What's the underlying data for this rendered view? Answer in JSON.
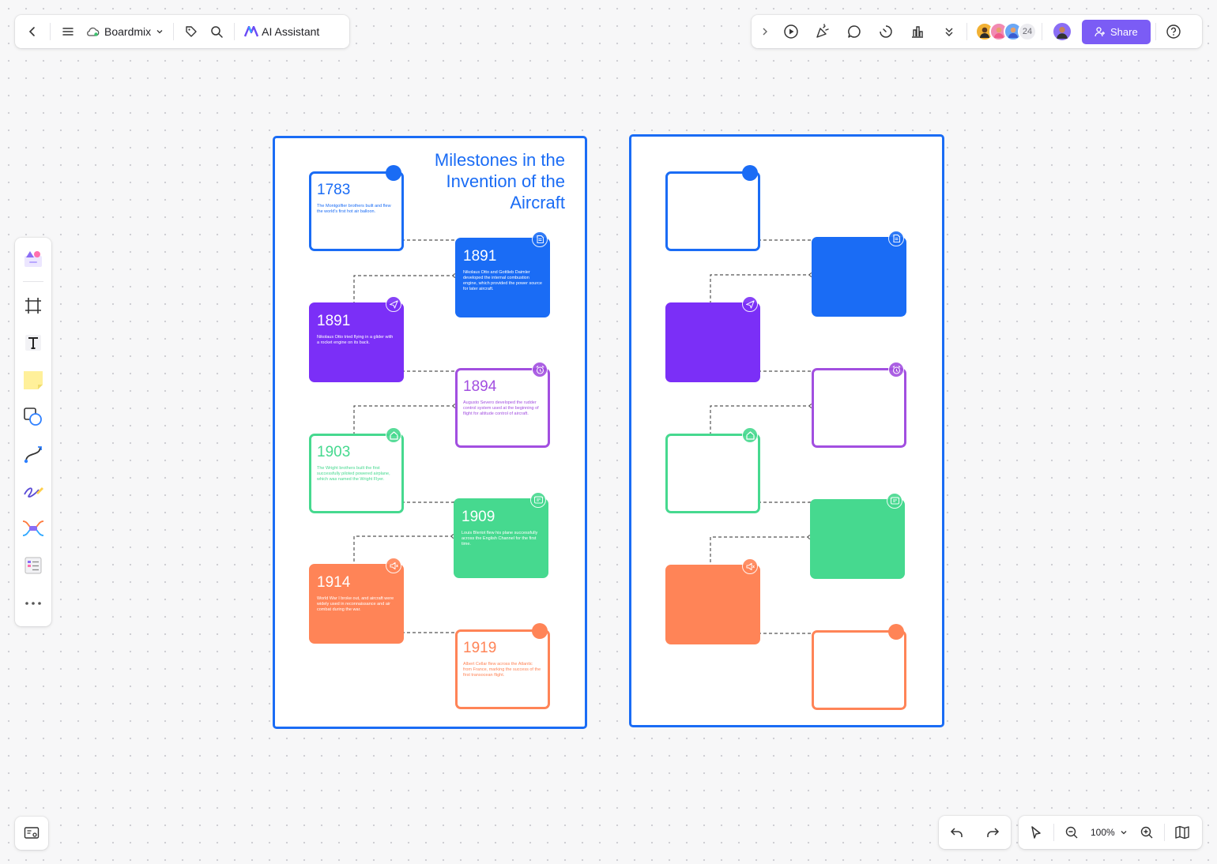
{
  "toolbar": {
    "app_name": "Boardmix",
    "ai_label": "AI Assistant",
    "collaborator_count": "24",
    "share_label": "Share",
    "zoom": "100%"
  },
  "board": {
    "title": "Milestones in the Invention of the Aircraft",
    "milestones": [
      {
        "year": "1783",
        "desc": "The Montgolfier brothers built and flew the world's first hot air balloon.",
        "color": "#1a6cf5",
        "style": "outline",
        "marker": "dot"
      },
      {
        "year": "1891",
        "desc": "Nikolaus Otto and Gottlieb Daimler developed the internal combustion engine, which provided the power source for later aircraft.",
        "color": "#1a6cf5",
        "style": "filled",
        "marker": "doc-icon"
      },
      {
        "year": "1891",
        "desc": "Nikolaus Otto tried flying in a glider with a rocket engine on its back.",
        "color": "#7b2ff7",
        "style": "filled",
        "marker": "send-icon"
      },
      {
        "year": "1894",
        "desc": "Augusto Severo developed the rudder control system used at the beginning of flight for altitude control of aircraft.",
        "color": "#a24fe0",
        "style": "outline",
        "marker": "alarm-icon"
      },
      {
        "year": "1903",
        "desc": "The Wright brothers built the first successfully piloted powered airplane, which was named the Wright Flyer.",
        "color": "#46d98f",
        "style": "outline",
        "marker": "home-icon"
      },
      {
        "year": "1909",
        "desc": "Louis Bleriot flew his plane successfully across the English Channel for the first time.",
        "color": "#46d98f",
        "style": "filled",
        "marker": "message-icon"
      },
      {
        "year": "1914",
        "desc": "World War I broke out, and aircraft were widely used in reconnaissance and air combat during the war.",
        "color": "#ff8457",
        "style": "filled",
        "marker": "speaker-icon"
      },
      {
        "year": "1919",
        "desc": "Albert Cellar flew across the Atlantic from France, marking the success of the first transocean flight.",
        "color": "#ff8457",
        "style": "outline",
        "marker": "dot"
      }
    ]
  }
}
